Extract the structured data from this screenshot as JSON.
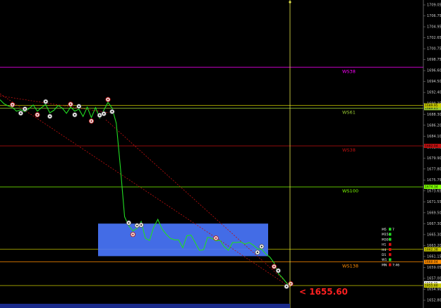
{
  "chart_data": {
    "type": "line",
    "price_axis": {
      "ticks": [
        "1709.05",
        "1706.75",
        "1704.95",
        "1702.65",
        "1700.75",
        "1698.75",
        "1696.60",
        "1694.50",
        "1692.40",
        "1690.35",
        "1688.30",
        "1686.20",
        "1684.10",
        "1682.05",
        "1679.90",
        "1677.80",
        "1675.75",
        "1673.65",
        "1671.55",
        "1669.50",
        "1667.30",
        "1665.30",
        "1663.20",
        "1661.15",
        "1659.05",
        "1657.00",
        "1654.90",
        "1652.80"
      ],
      "range": [
        1652.8,
        1709.05
      ]
    },
    "horizontal_levels": [
      {
        "label": "WS38",
        "price": 1697.2,
        "color": "#ff00ff",
        "badge": ""
      },
      {
        "label": "WS61",
        "price": 1689.4,
        "color": "#9acd32",
        "badge": "1689.45"
      },
      {
        "label": "",
        "price": 1689.9,
        "color": "#c8c800",
        "badge": "1689.95"
      },
      {
        "label": "WS38",
        "price": 1682.2,
        "color": "#c01010",
        "badge": "1682.04"
      },
      {
        "label": "WS100",
        "price": 1674.4,
        "color": "#7cfc00",
        "badge": "1674.34"
      },
      {
        "label": "",
        "price": 1662.5,
        "color": "#c8c800",
        "badge": "1662.38"
      },
      {
        "label": "WS138",
        "price": 1660.1,
        "color": "#ff8c00",
        "badge": "1660.04"
      },
      {
        "label": "",
        "price": 1655.6,
        "color": "#c8c800",
        "badge": "1655.60"
      }
    ],
    "current_price_label": "< 1655.60",
    "right_badges": [
      "1656.05",
      "1655.60"
    ],
    "vertical_line_label": "",
    "price_series": [
      1691,
      1690.2,
      1689.8,
      1689.5,
      1688.8,
      1689.1,
      1688.7,
      1689.3,
      1690,
      1688.8,
      1689.5,
      1690.1,
      1688.5,
      1689,
      1689.9,
      1689.4,
      1688.4,
      1689.6,
      1688.8,
      1689.2,
      1687.8,
      1689.6,
      1687.6,
      1689.5,
      1687.5,
      1689,
      1690.5,
      1689.4,
      1686.5,
      1678,
      1668.7,
      1667,
      1666,
      1666.5,
      1667.8,
      1664.6,
      1664.2,
      1666.7,
      1668.2,
      1666.4,
      1665.4,
      1664.6,
      1664.3,
      1664.3,
      1662.8,
      1665.1,
      1665.2,
      1663.8,
      1662.3,
      1662.4,
      1664.8,
      1664.6,
      1664.1,
      1664.2,
      1663,
      1662.3,
      1663.8,
      1663.8,
      1663.9,
      1663.5,
      1663.8,
      1663.3,
      1662.6,
      1662.5,
      1661.6,
      1661,
      1659.9,
      1657.9,
      1657.1,
      1656.1,
      1655.4
    ],
    "box": {
      "price_top": 1667.4,
      "price_bottom": 1661.2,
      "color": "#4a78ff"
    },
    "timeframes": [
      {
        "name": "M5",
        "value": "7"
      },
      {
        "name": "M15",
        "value": ""
      },
      {
        "name": "M30",
        "value": ""
      },
      {
        "name": "H1",
        "value": ""
      },
      {
        "name": "H4",
        "value": ""
      },
      {
        "name": "D1",
        "value": ""
      },
      {
        "name": "W1",
        "value": ""
      },
      {
        "name": "MN",
        "value": "7:46"
      }
    ],
    "background": "#000000",
    "grid": false
  }
}
